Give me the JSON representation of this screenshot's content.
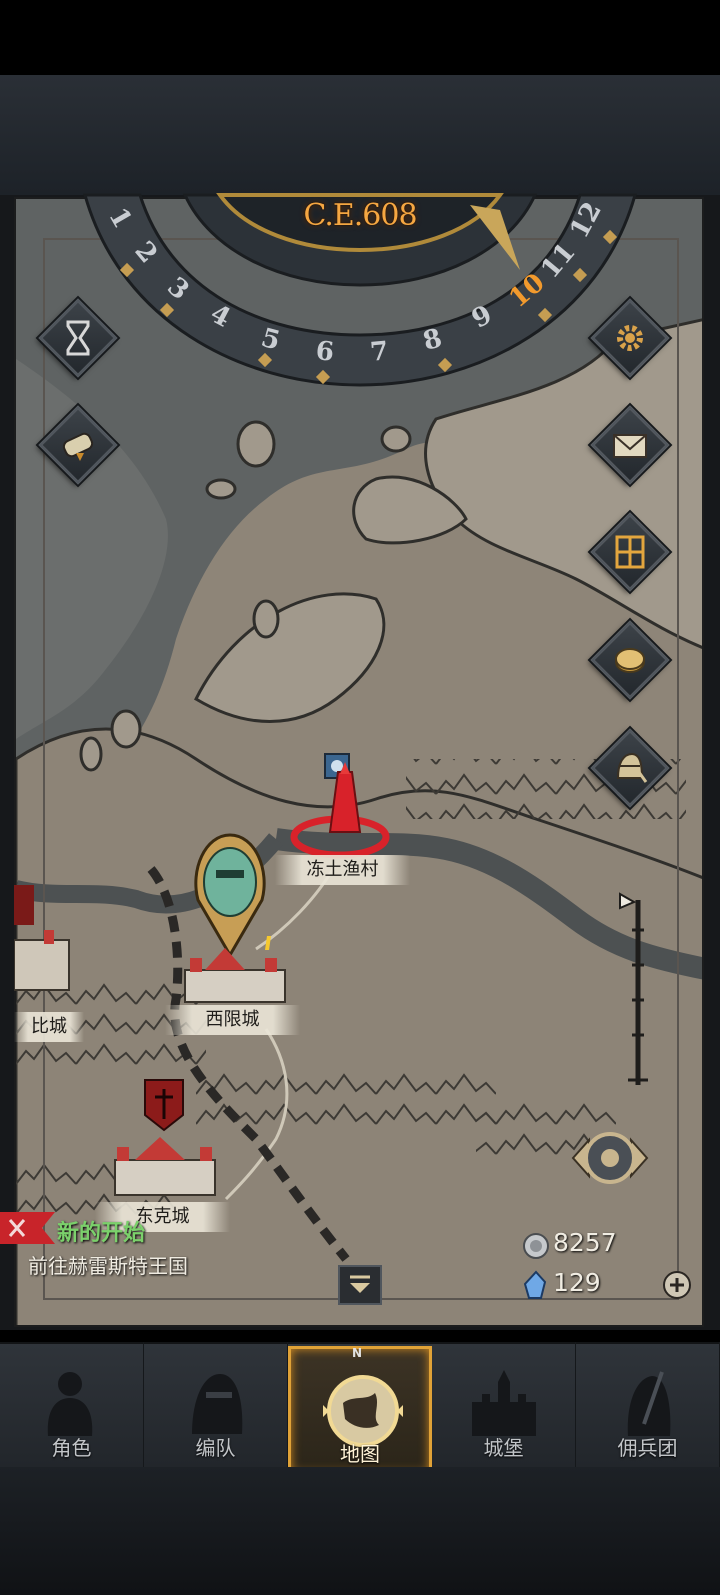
{
  "header": {
    "year": "C.E.608"
  },
  "dial": {
    "numbers": [
      "1",
      "2",
      "3",
      "4",
      "5",
      "6",
      "7",
      "8",
      "9",
      "10",
      "11",
      "12"
    ],
    "current": "10"
  },
  "left_buttons": [
    {
      "name": "hourglass-button",
      "icon": "hourglass-icon"
    },
    {
      "name": "scroll-button",
      "icon": "scroll-icon"
    }
  ],
  "right_buttons": [
    {
      "name": "settings-button",
      "icon": "gear-icon"
    },
    {
      "name": "mail-button",
      "icon": "envelope-icon"
    },
    {
      "name": "window-button",
      "icon": "grid-window-icon"
    },
    {
      "name": "coin-button",
      "icon": "coin-icon"
    },
    {
      "name": "knight-button",
      "icon": "knight-helmet-icon"
    }
  ],
  "places": {
    "fishing_village": "冻土渔村",
    "west_city": "西限城",
    "east_city": "东克城",
    "left_city": "比城"
  },
  "quest": {
    "title": "新的开始",
    "description": "前往赫雷斯特王国"
  },
  "resources": {
    "silver": "8257",
    "crystal": "129"
  },
  "compass_mark": "N",
  "nav": {
    "tabs": [
      {
        "label": "角色",
        "icon": "character-icon"
      },
      {
        "label": "编队",
        "icon": "formation-icon"
      },
      {
        "label": "地图",
        "icon": "map-icon",
        "active": true
      },
      {
        "label": "城堡",
        "icon": "castle-icon"
      },
      {
        "label": "佣兵团",
        "icon": "mercenary-icon"
      }
    ]
  },
  "colors": {
    "accent": "#e0a237",
    "quest_green": "#7bd06b",
    "year_orange": "#f5a742",
    "enemy_red": "#d8222a",
    "map_parchment": "#8e8578"
  }
}
